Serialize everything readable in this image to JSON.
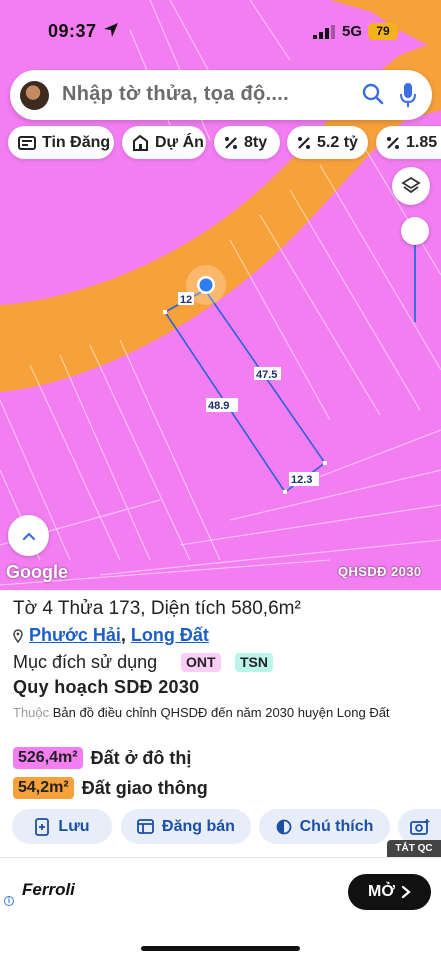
{
  "status": {
    "time": "09:37",
    "network": "5G",
    "battery": "79"
  },
  "search": {
    "placeholder": "Nhập tờ thửa, tọa độ...."
  },
  "chips": [
    {
      "label": "Tin Đăng",
      "icon": "listing-icon"
    },
    {
      "label": "Dự Án",
      "icon": "building-icon"
    },
    {
      "label": "8ty",
      "icon": "percent-icon"
    },
    {
      "label": "5.2 tỷ",
      "icon": "percent-icon"
    },
    {
      "label": "1.85",
      "icon": "percent-icon"
    }
  ],
  "map": {
    "google_label": "Google",
    "layer_label": "QHSDĐ 2030",
    "edge_labels": [
      "12",
      "47.5",
      "48.9",
      "12.3"
    ],
    "colors": {
      "residential": "#f37ef2",
      "road": "#f7a13b",
      "parcel_outline": "#2b63d9"
    }
  },
  "panel": {
    "title": "Tờ 4 Thửa 173, Diện tích 580,6m²",
    "ward": "Phước Hải",
    "separator": ",",
    "district": "Long Đất",
    "purpose_label": "Mục đích sử dụng",
    "tags": [
      "ONT",
      "TSN"
    ],
    "plan_title": "Quy hoạch SDĐ 2030",
    "plan_prefix": "Thuộc",
    "plan_desc": "Bản đồ điều chỉnh QHSDĐ đến năm 2030 huyện Long Đất",
    "areas": [
      {
        "value": "526,4m²",
        "name": "Đất ở đô thị",
        "color": "#f37ef2"
      },
      {
        "value": "54,2m²",
        "name": "Đất giao thông",
        "color": "#f7a13b"
      }
    ],
    "actions": [
      {
        "label": "Lưu",
        "icon": "save-icon"
      },
      {
        "label": "Đăng bán",
        "icon": "post-listing-icon"
      },
      {
        "label": "Chú thích",
        "icon": "legend-icon"
      },
      {
        "label": "",
        "icon": "camera-icon"
      }
    ]
  },
  "ad": {
    "close_label": "TẮT QC",
    "brand": "Ferroli",
    "cta": "MỞ"
  }
}
